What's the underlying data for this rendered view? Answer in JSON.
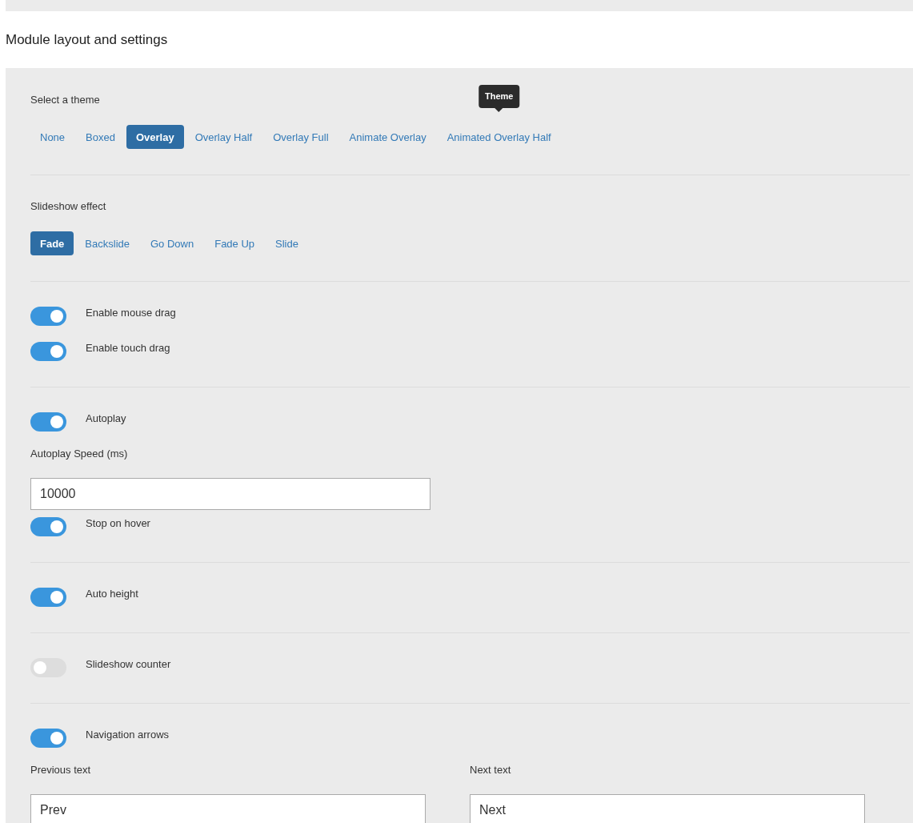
{
  "header": {
    "title": "Module layout and settings"
  },
  "sections": [
    {
      "items": [
        {
          "kind": "pills",
          "label": "Select a theme",
          "options": [
            {
              "label": "None",
              "selected": false
            },
            {
              "label": "Boxed",
              "selected": false
            },
            {
              "label": "Overlay",
              "selected": true
            },
            {
              "label": "Overlay Half",
              "selected": false
            },
            {
              "label": "Overlay Full",
              "selected": false
            },
            {
              "label": "Animate Overlay",
              "selected": false
            },
            {
              "label": "Animated Overlay Half",
              "selected": false,
              "tooltip": "Theme"
            }
          ]
        }
      ]
    },
    {
      "items": [
        {
          "kind": "pills",
          "label": "Slideshow effect",
          "options": [
            {
              "label": "Fade",
              "selected": true
            },
            {
              "label": "Backslide",
              "selected": false
            },
            {
              "label": "Go Down",
              "selected": false
            },
            {
              "label": "Fade Up",
              "selected": false
            },
            {
              "label": "Slide",
              "selected": false
            }
          ]
        }
      ]
    },
    {
      "items": [
        {
          "kind": "toggle",
          "label": "Enable mouse drag",
          "on": true
        },
        {
          "kind": "toggle",
          "label": "Enable touch drag",
          "on": true
        }
      ]
    },
    {
      "items": [
        {
          "kind": "toggle",
          "label": "Autoplay",
          "on": true
        },
        {
          "kind": "field",
          "label": "Autoplay Speed (ms)",
          "value": "10000"
        },
        {
          "kind": "toggle",
          "label": "Stop on hover",
          "on": true
        }
      ]
    },
    {
      "items": [
        {
          "kind": "toggle",
          "label": "Auto height",
          "on": true
        }
      ]
    },
    {
      "items": [
        {
          "kind": "toggle",
          "label": "Slideshow counter",
          "on": false
        }
      ]
    },
    {
      "items": [
        {
          "kind": "toggle",
          "label": "Navigation arrows",
          "on": true
        },
        {
          "kind": "field_pair",
          "fields": [
            {
              "label": "Previous text",
              "value": "Prev"
            },
            {
              "label": "Next text",
              "value": "Next"
            }
          ]
        }
      ]
    }
  ]
}
